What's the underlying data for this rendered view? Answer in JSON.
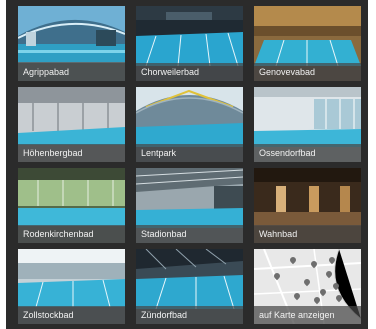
{
  "tiles": [
    {
      "label": "Agrippabad",
      "scene": "arched-roof-pool"
    },
    {
      "label": "Chorweilerbad",
      "scene": "dark-hall-pool"
    },
    {
      "label": "Genovevabad",
      "scene": "wooden-hall-pool"
    },
    {
      "label": "Höhenbergbad",
      "scene": "glass-hall-pool"
    },
    {
      "label": "Lentpark",
      "scene": "arched-roof-pool"
    },
    {
      "label": "Ossendorfbad",
      "scene": "glass-hall-pool"
    },
    {
      "label": "Rodenkirchenbad",
      "scene": "glass-hall-pool"
    },
    {
      "label": "Stadionbad",
      "scene": "dark-hall-pool"
    },
    {
      "label": "Wahnbad",
      "scene": "wooden-hall-pool"
    },
    {
      "label": "Zollstockbad",
      "scene": "glass-hall-pool"
    },
    {
      "label": "Zündorfbad",
      "scene": "dark-hall-pool"
    },
    {
      "label": "auf Karte anzeigen",
      "scene": "map"
    }
  ],
  "icons": {
    "map_pin": "map-pin-icon"
  },
  "colors": {
    "background": "#2b2b2b",
    "caption_overlay": "#464646",
    "water": "#3fb3d6",
    "map": "#e7e7e7"
  }
}
